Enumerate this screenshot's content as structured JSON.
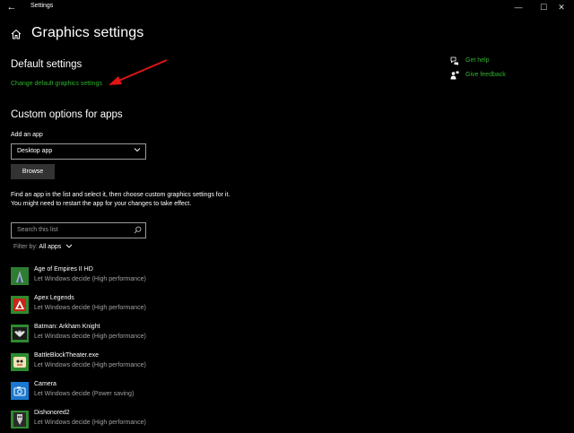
{
  "window": {
    "title": "Settings",
    "back_glyph": "←",
    "minimize_glyph": "—",
    "maximize_glyph": "☐",
    "close_glyph": "✕"
  },
  "page": {
    "title": "Graphics settings",
    "home_icon": "home-icon"
  },
  "default_settings": {
    "heading": "Default settings",
    "link": "Change default graphics settings"
  },
  "custom": {
    "heading": "Custom options for apps",
    "add_label": "Add an app",
    "dropdown_value": "Desktop app",
    "browse_label": "Browse",
    "description": "Find an app in the list and select it, then choose custom graphics settings for it. You might need to restart the app for your changes to take effect.",
    "search_placeholder": "Search this list",
    "filter_label": "Filter by:",
    "filter_value": "All apps"
  },
  "apps": [
    {
      "name": "Age of Empires II HD",
      "pref": "Let Windows decide (High performance)",
      "icon": "age-of-empires-icon",
      "color": "#3a7a2a"
    },
    {
      "name": "Apex Legends",
      "pref": "Let Windows decide (High performance)",
      "icon": "apex-legends-icon",
      "color": "#3a8a2a"
    },
    {
      "name": "Batman: Arkham Knight",
      "pref": "Let Windows decide (High performance)",
      "icon": "batman-icon",
      "color": "#3a8a2a"
    },
    {
      "name": "BattleBlockTheater.exe",
      "pref": "Let Windows decide (High performance)",
      "icon": "battleblock-icon",
      "color": "#3a8a2a"
    },
    {
      "name": "Camera",
      "pref": "Let Windows decide (Power saving)",
      "icon": "camera-icon",
      "color": "#1a78d0"
    },
    {
      "name": "Dishonored2",
      "pref": "Let Windows decide (High performance)",
      "icon": "dishonored-icon",
      "color": "#3a8a2a"
    }
  ],
  "help": {
    "get_help": "Get help",
    "give_feedback": "Give feedback"
  },
  "colors": {
    "accent": "#2fb12f",
    "background": "#000000",
    "annotation_arrow": "#e01515"
  }
}
